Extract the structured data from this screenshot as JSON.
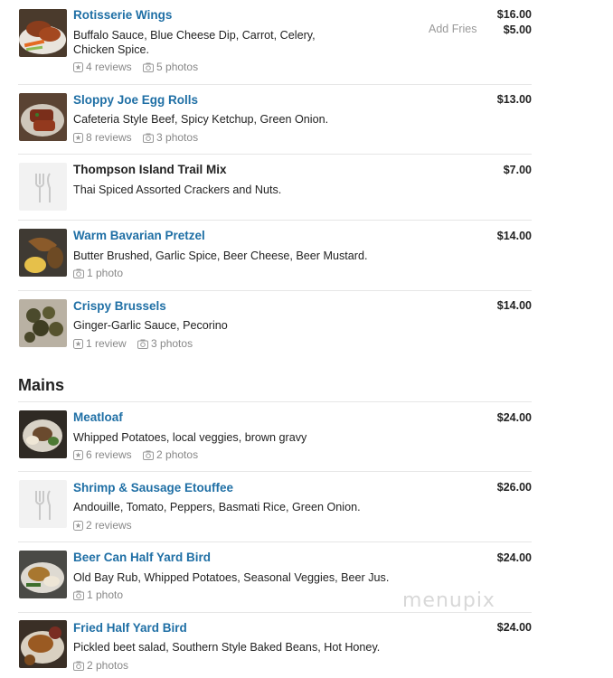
{
  "sections": {
    "mains_title": "Mains"
  },
  "items": [
    {
      "name": "Rotisserie Wings",
      "desc": "Buffalo Sauce, Blue Cheese Dip, Carrot, Celery, Chicken Spice.",
      "price": "$16.00",
      "addon_label": "Add Fries",
      "addon_price": "$5.00",
      "reviews": "4 reviews",
      "photos": "5 photos"
    },
    {
      "name": "Sloppy Joe Egg Rolls",
      "desc": "Cafeteria Style Beef, Spicy Ketchup, Green Onion.",
      "price": "$13.00",
      "reviews": "8 reviews",
      "photos": "3 photos"
    },
    {
      "name": "Thompson Island Trail Mix",
      "desc": "Thai Spiced Assorted Crackers and Nuts.",
      "price": "$7.00"
    },
    {
      "name": "Warm Bavarian Pretzel",
      "desc": "Butter Brushed, Garlic Spice, Beer Cheese, Beer Mustard.",
      "price": "$14.00",
      "photos": "1 photo"
    },
    {
      "name": "Crispy Brussels",
      "desc": "Ginger-Garlic Sauce, Pecorino",
      "price": "$14.00",
      "reviews": "1 review",
      "photos": "3 photos"
    },
    {
      "name": "Meatloaf",
      "desc": "Whipped Potatoes, local veggies, brown gravy",
      "price": "$24.00",
      "reviews": "6 reviews",
      "photos": "2 photos"
    },
    {
      "name": "Shrimp & Sausage Etouffee",
      "desc": "Andouille, Tomato, Peppers, Basmati Rice, Green Onion.",
      "price": "$26.00",
      "reviews": "2 reviews"
    },
    {
      "name": "Beer Can Half Yard Bird",
      "desc": "Old Bay Rub, Whipped Potatoes, Seasonal Veggies, Beer Jus.",
      "price": "$24.00",
      "photos": "1 photo"
    },
    {
      "name": "Fried Half Yard Bird",
      "desc": "Pickled beet salad, Southern Style Baked Beans, Hot Honey.",
      "price": "$24.00",
      "photos": "2 photos"
    }
  ],
  "watermark": "menupix",
  "colors": {
    "link": "#1f6fa5",
    "muted": "#888888",
    "divider": "#e6e6e6"
  }
}
